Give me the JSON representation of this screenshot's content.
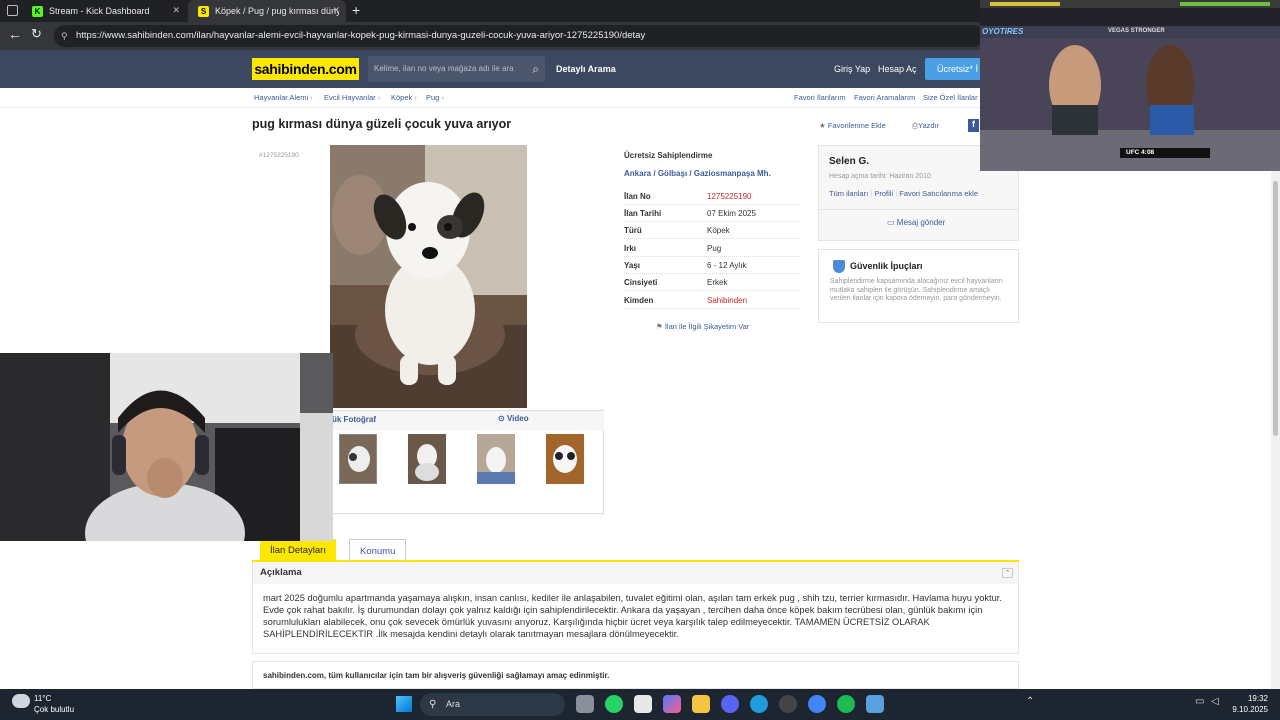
{
  "browser": {
    "tabs": [
      {
        "label": "Stream - Kick Dashboard",
        "favicon": "K"
      },
      {
        "label": "Köpek / Pug / pug kırması dünya",
        "favicon": "S"
      }
    ],
    "url": "https://www.sahibinden.com/ilan/hayvanlar-alemi-evcil-hayvanlar-kopek-pug-kirmasi-dunya-guzeli-cocuk-yuva-ariyor-1275225190/detay"
  },
  "header": {
    "logo": "sahibinden.com",
    "search_placeholder": "Kelime, ilan no veya mağaza adı ile ara",
    "detailed_search": "Detaylı Arama",
    "login": "Giriş Yap",
    "register": "Hesap Aç",
    "post_ad": "Ücretsiz* İ"
  },
  "breadcrumb": [
    "Hayvanlar Alemi",
    "Evcil Hayvanlar",
    "Köpek",
    "Pug"
  ],
  "breadcrumb_sep": "›",
  "favorites_links": [
    "Favori İlanlarım",
    "Favori Aramalarım",
    "Size Özel İlanlar"
  ],
  "listing": {
    "title": "pug kırması dünya güzeli çocuk yuva arıyor",
    "add_favorite": "Favorilerime Ekle",
    "print": "Yazdır",
    "id_tag": "#1275225190",
    "photo_tabs": {
      "photos": "ük Fotoğraf",
      "video": "Video"
    },
    "category": "Ücretsiz Sahiplendirme",
    "location": [
      "Ankara",
      "Gölbaşı",
      "Gaziosmanpaşa Mh."
    ],
    "location_sep": "/",
    "details": [
      {
        "key": "İlan No",
        "value": "1275225190",
        "highlight": true
      },
      {
        "key": "İlan Tarihi",
        "value": "07 Ekim 2025",
        "highlight": false
      },
      {
        "key": "Türü",
        "value": "Köpek",
        "highlight": false
      },
      {
        "key": "Irkı",
        "value": "Pug",
        "highlight": false
      },
      {
        "key": "Yaşı",
        "value": "6 - 12 Aylık",
        "highlight": false
      },
      {
        "key": "Cinsiyeti",
        "value": "Erkek",
        "highlight": false
      },
      {
        "key": "Kimden",
        "value": "Sahibinden",
        "highlight": true
      }
    ],
    "complaint": "İlan ile İlgili Şikayetim Var"
  },
  "seller": {
    "name": "Selen G.",
    "since": "Hesap açma tarihi: Haziran 2010",
    "links": [
      "Tüm ilanları",
      "Profili",
      "Favori Satıcılarıma ekle"
    ],
    "message": "Mesaj gönder"
  },
  "safety": {
    "title": "Güvenlik İpuçları",
    "text": "Sahiplendirme kapsamında alacağınız evcil hayvanların mutlaka sahipleri ile görüşün. Sahiplendirme amaçlı verilen ilanlar için kapora ödemeyin, para göndermeyin."
  },
  "page_tabs": [
    "İlan Detayları",
    "Konumu"
  ],
  "description": {
    "header": "Açıklama",
    "text": "mart 2025 doğumlu apartmanda yaşamaya alışkın, insan canlısı, kediler ile anlaşabilen, tuvalet eğitimi olan, aşıları tam erkek pug , shih tzu, terrier kırmasıdır. Havlama huyu yoktur. Evde çok rahat bakılır. İş durumundan dolayı çok yalnız kaldığı için sahiplendirilecektir. Ankara da yaşayan , tercihen daha önce köpek bakım tecrübesi olan, günlük bakımı için sorumlulukları alabilecek, onu çok sevecek ömürlük yuvasını arıyoruz. Karşılığında hiçbir ücret veya karşılık talep edilmeyecektir. TAMAMEN ÜCRETSİZ OLARAK SAHİPLENDİRİLECEKTİR .İlk mesajda kendini detaylı olarak tanıtmayan mesajlara dönülmeyecektir."
  },
  "footer_note": "sahibinden.com, tüm kullanıcılar için tam bir alışveriş güvenliği sağlamayı amaç edinmiştir.",
  "stream_overlay": {
    "brand": "OYOTIRES",
    "banner": "VEGAS STRONGER",
    "scorebug": "UFC 4:08"
  },
  "taskbar": {
    "weather_temp": "11°C",
    "weather_desc": "Çok bulutlu",
    "search": "Ara",
    "time": "19:32",
    "date": "9.10.2025"
  },
  "colors": {
    "header_bg": "#3c4860",
    "logo_bg": "#ffe800",
    "link": "#3c5a9a",
    "red": "#c82828",
    "taskbar": "#1c2530"
  }
}
